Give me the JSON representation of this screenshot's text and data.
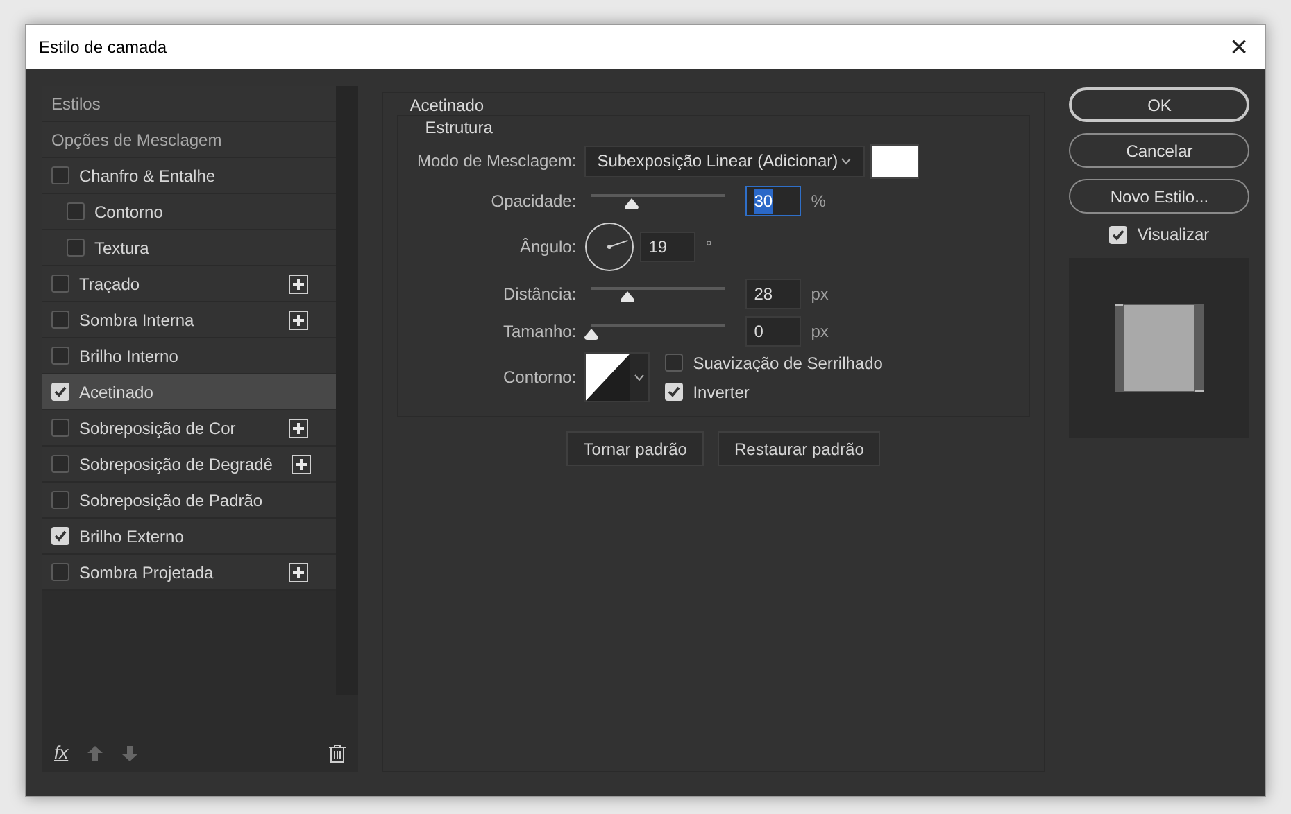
{
  "window": {
    "title": "Estilo de camada",
    "close": "×"
  },
  "styles_list": {
    "items": [
      {
        "kind": "header",
        "label": "Estilos",
        "selected": false
      },
      {
        "kind": "header",
        "label": "Opções de Mesclagem",
        "selected": false
      },
      {
        "kind": "effect",
        "label": "Chanfro & Entalhe",
        "checked": false,
        "selected": false,
        "add_button": false,
        "children": [
          {
            "kind": "effect",
            "label": "Contorno",
            "checked": false,
            "selected": false,
            "add_button": false
          },
          {
            "kind": "effect",
            "label": "Textura",
            "checked": false,
            "selected": false,
            "add_button": false
          }
        ]
      },
      {
        "kind": "effect",
        "label": "Traçado",
        "checked": false,
        "selected": false,
        "add_button": true
      },
      {
        "kind": "effect",
        "label": "Sombra Interna",
        "checked": false,
        "selected": false,
        "add_button": true
      },
      {
        "kind": "effect",
        "label": "Brilho Interno",
        "checked": false,
        "selected": false,
        "add_button": false
      },
      {
        "kind": "effect",
        "label": "Acetinado",
        "checked": true,
        "selected": true,
        "add_button": false
      },
      {
        "kind": "effect",
        "label": "Sobreposição de Cor",
        "checked": false,
        "selected": false,
        "add_button": true
      },
      {
        "kind": "effect",
        "label": "Sobreposição de Degradê",
        "checked": false,
        "selected": false,
        "add_button": true
      },
      {
        "kind": "effect",
        "label": "Sobreposição de Padrão",
        "checked": false,
        "selected": false,
        "add_button": false
      },
      {
        "kind": "effect",
        "label": "Brilho Externo",
        "checked": true,
        "selected": false,
        "add_button": false
      },
      {
        "kind": "effect",
        "label": "Sombra Projetada",
        "checked": false,
        "selected": false,
        "add_button": true
      }
    ],
    "footer": {
      "fx": "fx"
    }
  },
  "panel": {
    "title": "Acetinado",
    "group_title": "Estrutura",
    "blend_mode": {
      "label": "Modo de Mesclagem:",
      "value": "Subexposição Linear (Adicionar)"
    },
    "opacity": {
      "label": "Opacidade:",
      "value": "30",
      "unit": "%",
      "level": 0.3
    },
    "angle": {
      "label": "Ângulo:",
      "value": "19",
      "unit": "°"
    },
    "distance": {
      "label": "Distância:",
      "value": "28",
      "unit": "px",
      "level": 0.27
    },
    "size": {
      "label": "Tamanho:",
      "value": "0",
      "unit": "px",
      "level": 0
    },
    "contour": {
      "label": "Contorno:"
    },
    "options": [
      {
        "label": "Suavização de Serrilhado",
        "checked": false
      },
      {
        "label": "Inverter",
        "checked": true
      }
    ],
    "buttons": [
      "Tornar padrão",
      "Restaurar padrão"
    ]
  },
  "actions": {
    "buttons": [
      "OK",
      "Cancelar",
      "Novo Estilo..."
    ],
    "preview": {
      "label": "Visualizar",
      "checked": true
    }
  }
}
